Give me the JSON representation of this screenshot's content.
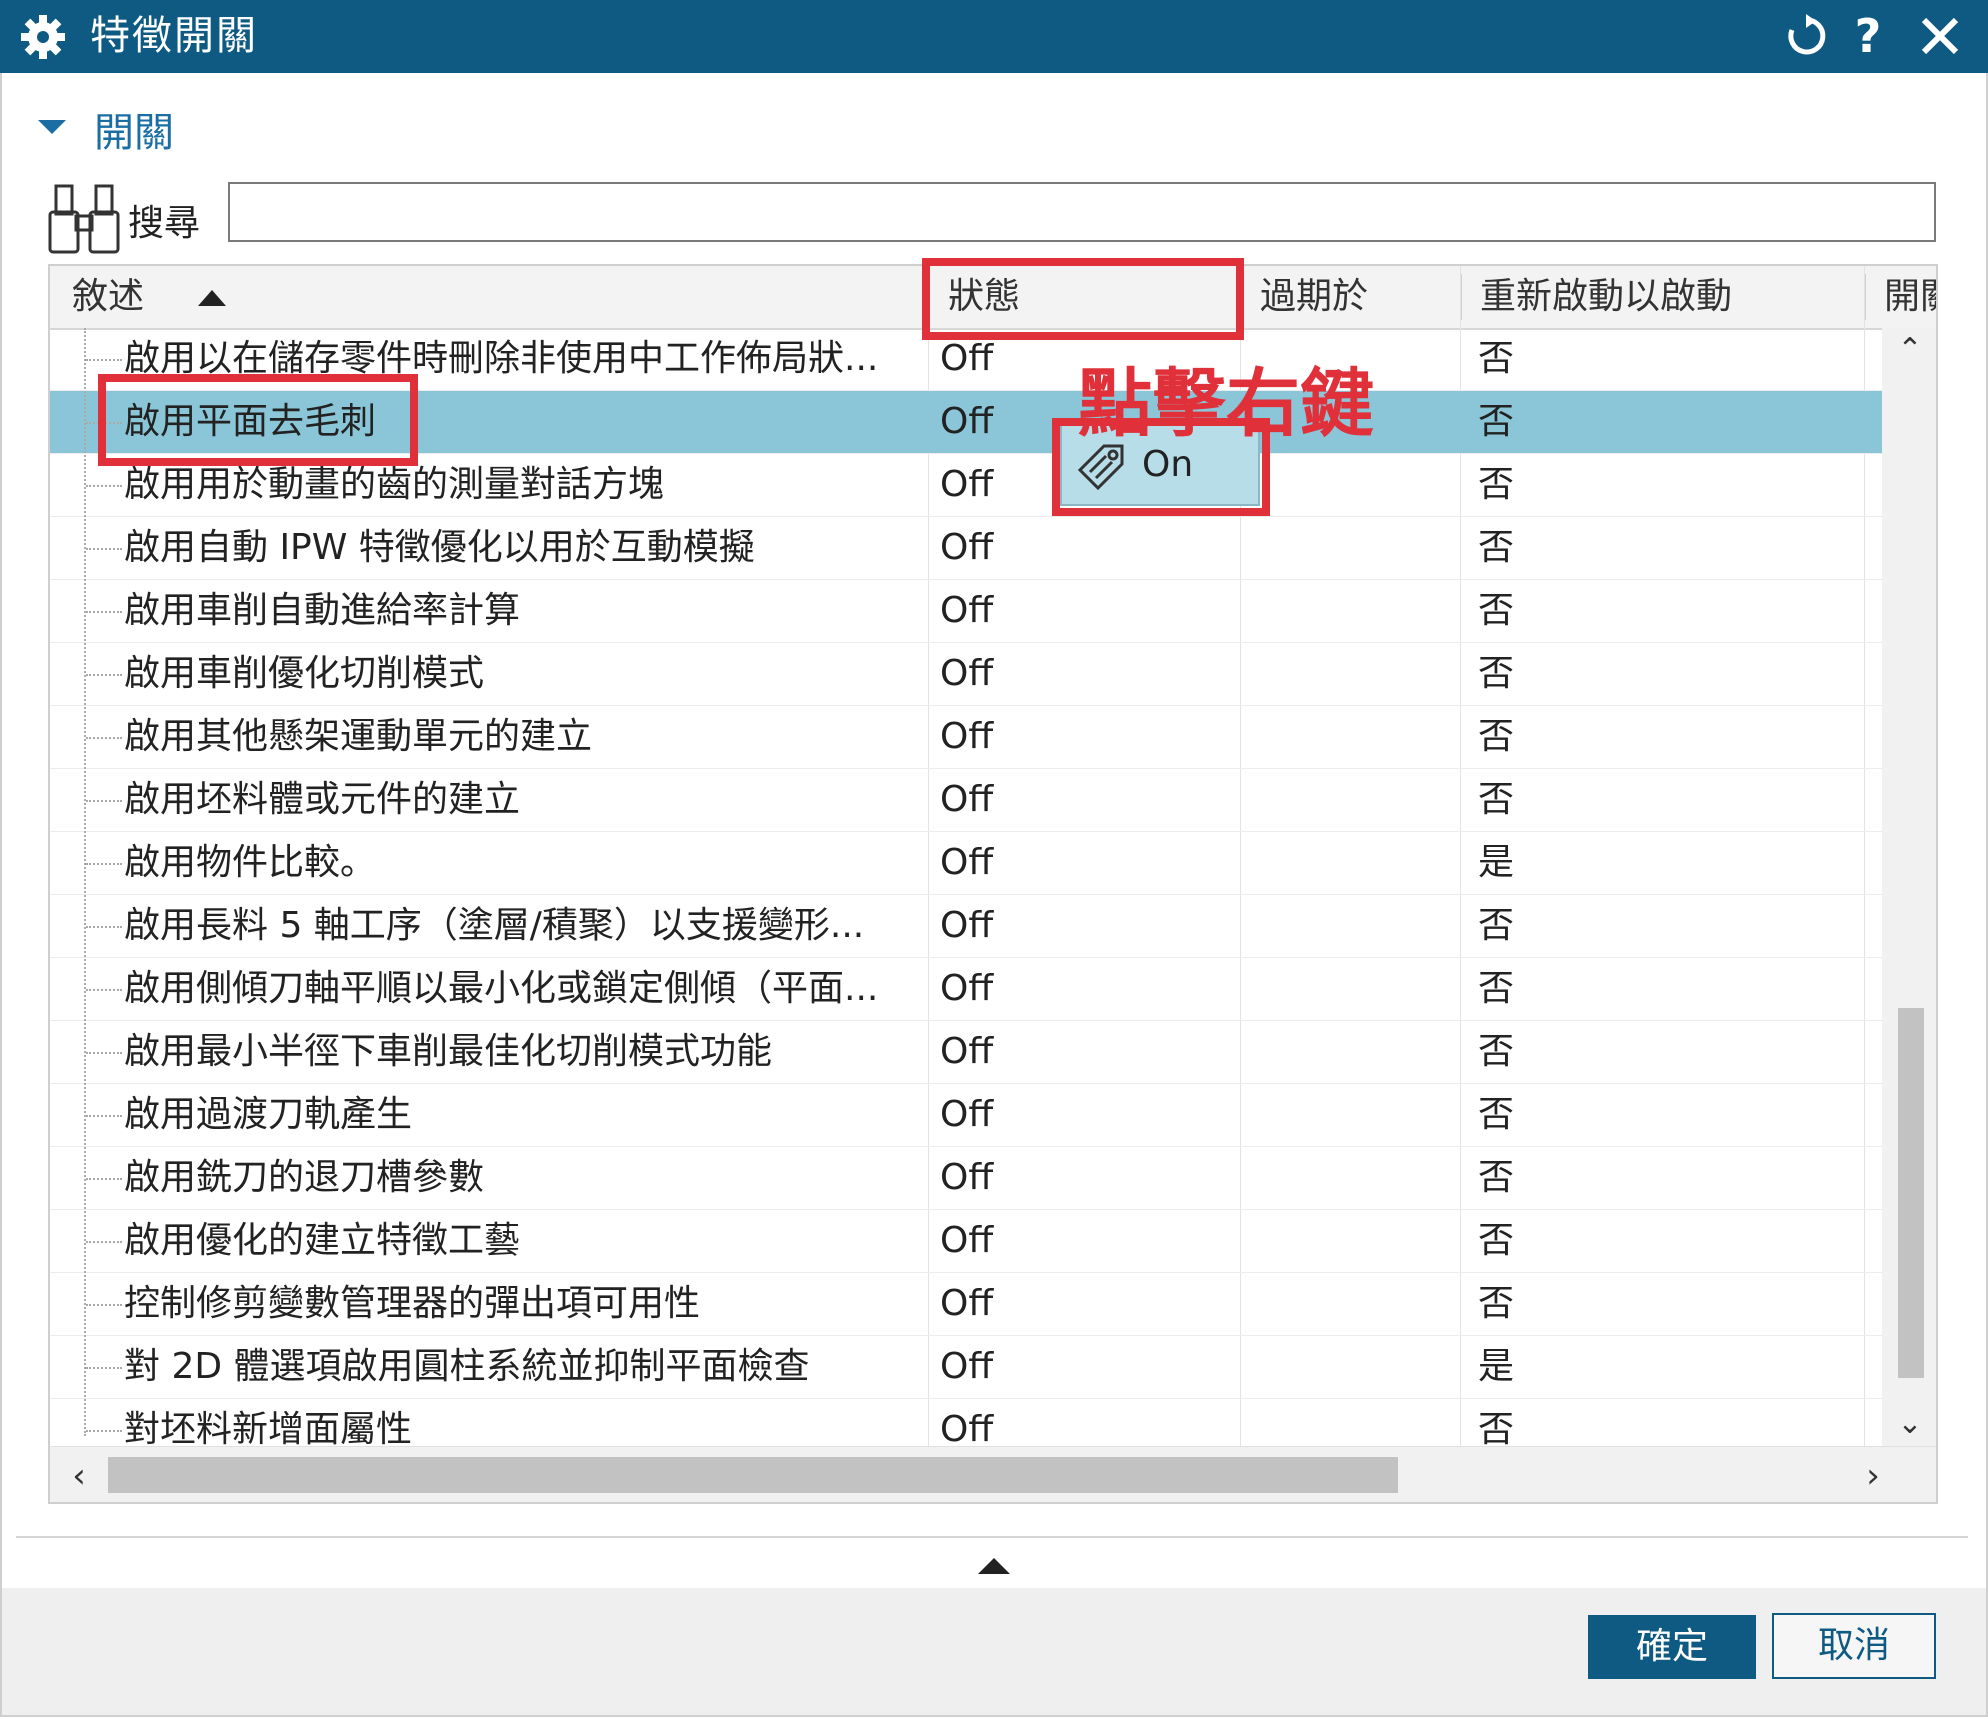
{
  "window": {
    "title": "特徵開關",
    "reset_icon": "reset-icon",
    "help_icon": "help-icon",
    "close_icon": "close-icon"
  },
  "group": {
    "label": "開關",
    "expanded": true
  },
  "search": {
    "label": "搜尋",
    "value": "",
    "placeholder": ""
  },
  "table": {
    "columns": [
      "敘述",
      "狀態",
      "過期於",
      "重新啟動以啟動",
      "開關"
    ],
    "sort_column": "敘述",
    "sort_direction": "ascending",
    "rows": [
      {
        "description": "啟用以在儲存零件時刪除非使用中工作佈局狀...",
        "status": "Off",
        "expires": "",
        "restart": "否"
      },
      {
        "description": "啟用平面去毛刺",
        "status": "Off",
        "expires": "",
        "restart": "否",
        "selected": true
      },
      {
        "description": "啟用用於動畫的齒的測量對話方塊",
        "status": "Off",
        "expires": "",
        "restart": "否"
      },
      {
        "description": "啟用自動 IPW 特徵優化以用於互動模擬",
        "status": "Off",
        "expires": "",
        "restart": "否"
      },
      {
        "description": "啟用車削自動進給率計算",
        "status": "Off",
        "expires": "",
        "restart": "否"
      },
      {
        "description": "啟用車削優化切削模式",
        "status": "Off",
        "expires": "",
        "restart": "否"
      },
      {
        "description": "啟用其他懸架運動單元的建立",
        "status": "Off",
        "expires": "",
        "restart": "否"
      },
      {
        "description": "啟用坯料體或元件的建立",
        "status": "Off",
        "expires": "",
        "restart": "否"
      },
      {
        "description": "啟用物件比較。",
        "status": "Off",
        "expires": "",
        "restart": "是"
      },
      {
        "description": "啟用長料 5 軸工序（塗層/積聚）以支援變形...",
        "status": "Off",
        "expires": "",
        "restart": "否"
      },
      {
        "description": "啟用側傾刀軸平順以最小化或鎖定側傾（平面...",
        "status": "Off",
        "expires": "",
        "restart": "否"
      },
      {
        "description": "啟用最小半徑下車削最佳化切削模式功能",
        "status": "Off",
        "expires": "",
        "restart": "否"
      },
      {
        "description": "啟用過渡刀軌產生",
        "status": "Off",
        "expires": "",
        "restart": "否"
      },
      {
        "description": "啟用銑刀的退刀槽參數",
        "status": "Off",
        "expires": "",
        "restart": "否"
      },
      {
        "description": "啟用優化的建立特徵工藝",
        "status": "Off",
        "expires": "",
        "restart": "否"
      },
      {
        "description": "控制修剪變數管理器的彈出項可用性",
        "status": "Off",
        "expires": "",
        "restart": "否"
      },
      {
        "description": "對 2D 體選項啟用圓柱系統並抑制平面檢查",
        "status": "Off",
        "expires": "",
        "restart": "是"
      },
      {
        "description": "對坯料新增面屬性",
        "status": "Off",
        "expires": "",
        "restart": "否"
      }
    ]
  },
  "context_menu": {
    "items": [
      {
        "label": "On",
        "icon": "tag-icon"
      }
    ]
  },
  "annotation": {
    "text": "點擊右鍵",
    "color": "#e0303a"
  },
  "buttons": {
    "ok": "確定",
    "cancel": "取消"
  },
  "colors": {
    "titlebar": "#0e5a82",
    "selection": "#8ac6d7",
    "accent": "#1a6ea3",
    "highlight": "#e0303a"
  }
}
